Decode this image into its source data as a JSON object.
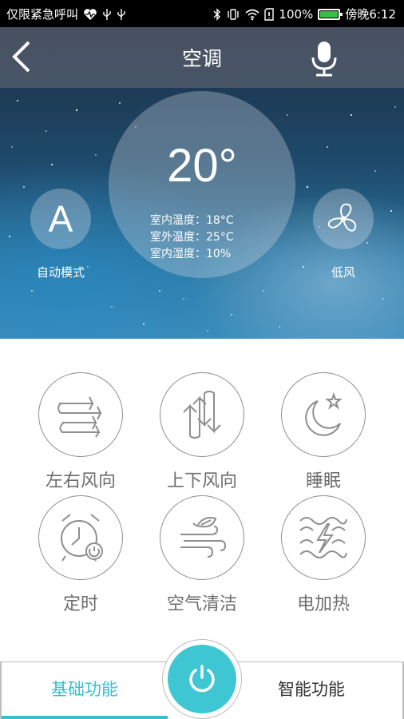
{
  "status_bar": {
    "left_text": "仅限紧急呼叫",
    "battery_percent": "100%",
    "time": "傍晚6:12",
    "icons": [
      "heart-rate-icon",
      "usb-icon",
      "usb-icon",
      "bluetooth-icon",
      "vibrate-icon",
      "wifi-icon",
      "sim-alert-icon",
      "battery-icon"
    ]
  },
  "header": {
    "title": "空调",
    "back_icon": "chevron-left-icon",
    "voice_icon": "microphone-icon"
  },
  "climate": {
    "set_temperature": "20°",
    "indoor_temp": "室内温度：18°C",
    "outdoor_temp": "室外温度：25°C",
    "indoor_humidity": "室内湿度：10%",
    "mode_label": "自动模式",
    "mode_icon_letter": "A",
    "fan_label": "低风",
    "fan_icon": "fan-icon"
  },
  "functions": [
    {
      "label": "左右风向",
      "icon": "horizontal-swing-icon"
    },
    {
      "label": "上下风向",
      "icon": "vertical-swing-icon"
    },
    {
      "label": "睡眠",
      "icon": "moon-star-icon"
    },
    {
      "label": "定时",
      "icon": "alarm-clock-icon"
    },
    {
      "label": "空气清洁",
      "icon": "air-purify-icon"
    },
    {
      "label": "电加热",
      "icon": "electric-heat-icon"
    }
  ],
  "bottom_bar": {
    "tab_basic": "基础功能",
    "tab_smart": "智能功能",
    "power_icon": "power-icon"
  },
  "colors": {
    "accent": "#3ec7d3",
    "label_gray": "#6d6d6d",
    "ring_gray": "#8f8f8f"
  }
}
